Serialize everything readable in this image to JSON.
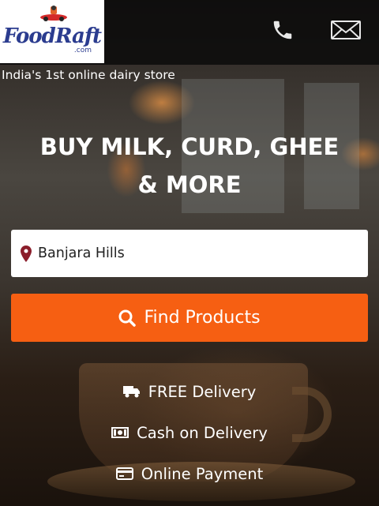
{
  "header": {
    "logo_text": "FoodRaft",
    "logo_sub": ".com",
    "phone_icon": "phone-icon",
    "mail_icon": "mail-icon"
  },
  "tagline": "India's 1st online dairy store",
  "headline": "BUY MILK, CURD, GHEE & MORE",
  "search": {
    "location_value": "Banjara Hills",
    "pin_icon": "map-pin-icon",
    "button_label": "Find Products",
    "button_icon": "search-icon"
  },
  "features": [
    {
      "label": "FREE Delivery",
      "icon": "truck-icon"
    },
    {
      "label": "Cash on Delivery",
      "icon": "money-icon"
    },
    {
      "label": "Online Payment",
      "icon": "credit-card-icon"
    }
  ],
  "colors": {
    "accent": "#f65f12",
    "brand": "#2b3c8f",
    "pin": "#8b1e2b"
  }
}
